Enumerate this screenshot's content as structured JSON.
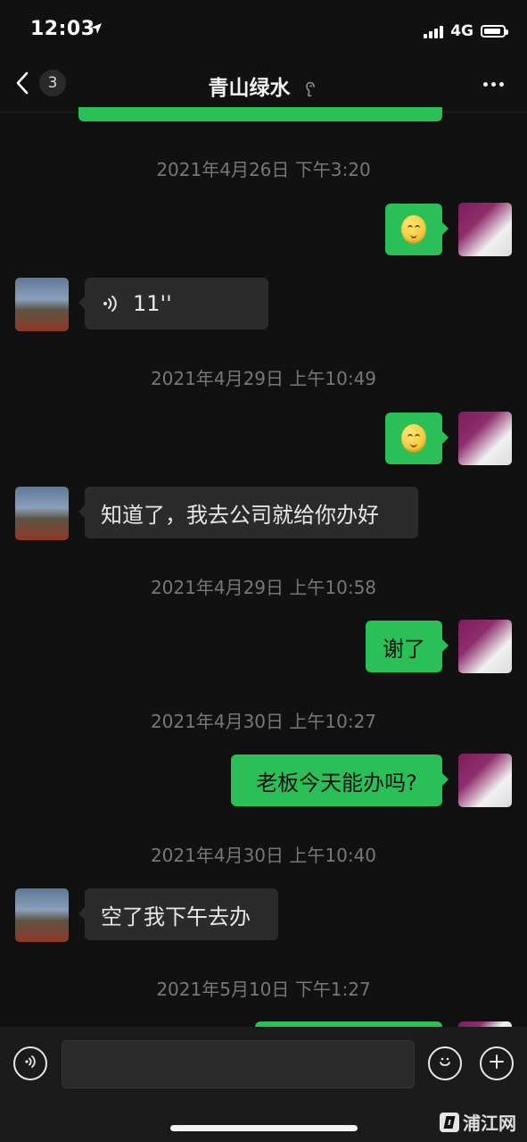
{
  "status_bar": {
    "time": "12:03",
    "network": "4G"
  },
  "nav": {
    "unread_count": "3",
    "title": "青山绿水"
  },
  "messages": {
    "ts1": "2021年4月26日 下午3:20",
    "ts2": "2021年4月29日 上午10:49",
    "ts3": "2021年4月29日 上午10:58",
    "ts4": "2021年4月30日 上午10:27",
    "ts5": "2021年4月30日 上午10:40",
    "ts6": "2021年5月10日 下午1:27",
    "voice_duration": "11''",
    "friend_text_1": "知道了，我去公司就给你办好",
    "self_text_1": "谢了",
    "self_text_2": "老板今天能办吗?",
    "friend_text_2": "空了我下午去办"
  },
  "watermark": {
    "text": "浦江网"
  },
  "colors": {
    "background": "#111111",
    "self_bubble": "#2bbf57",
    "friend_bubble": "#2b2b2b",
    "timestamp": "#777777"
  },
  "icons": {
    "back": "chevron-left-icon",
    "mute": "ear-mute-icon",
    "more": "more-horizontal-icon",
    "voice": "voice-wave-icon",
    "emoji": "smile-emoji-icon",
    "plus": "plus-icon"
  }
}
